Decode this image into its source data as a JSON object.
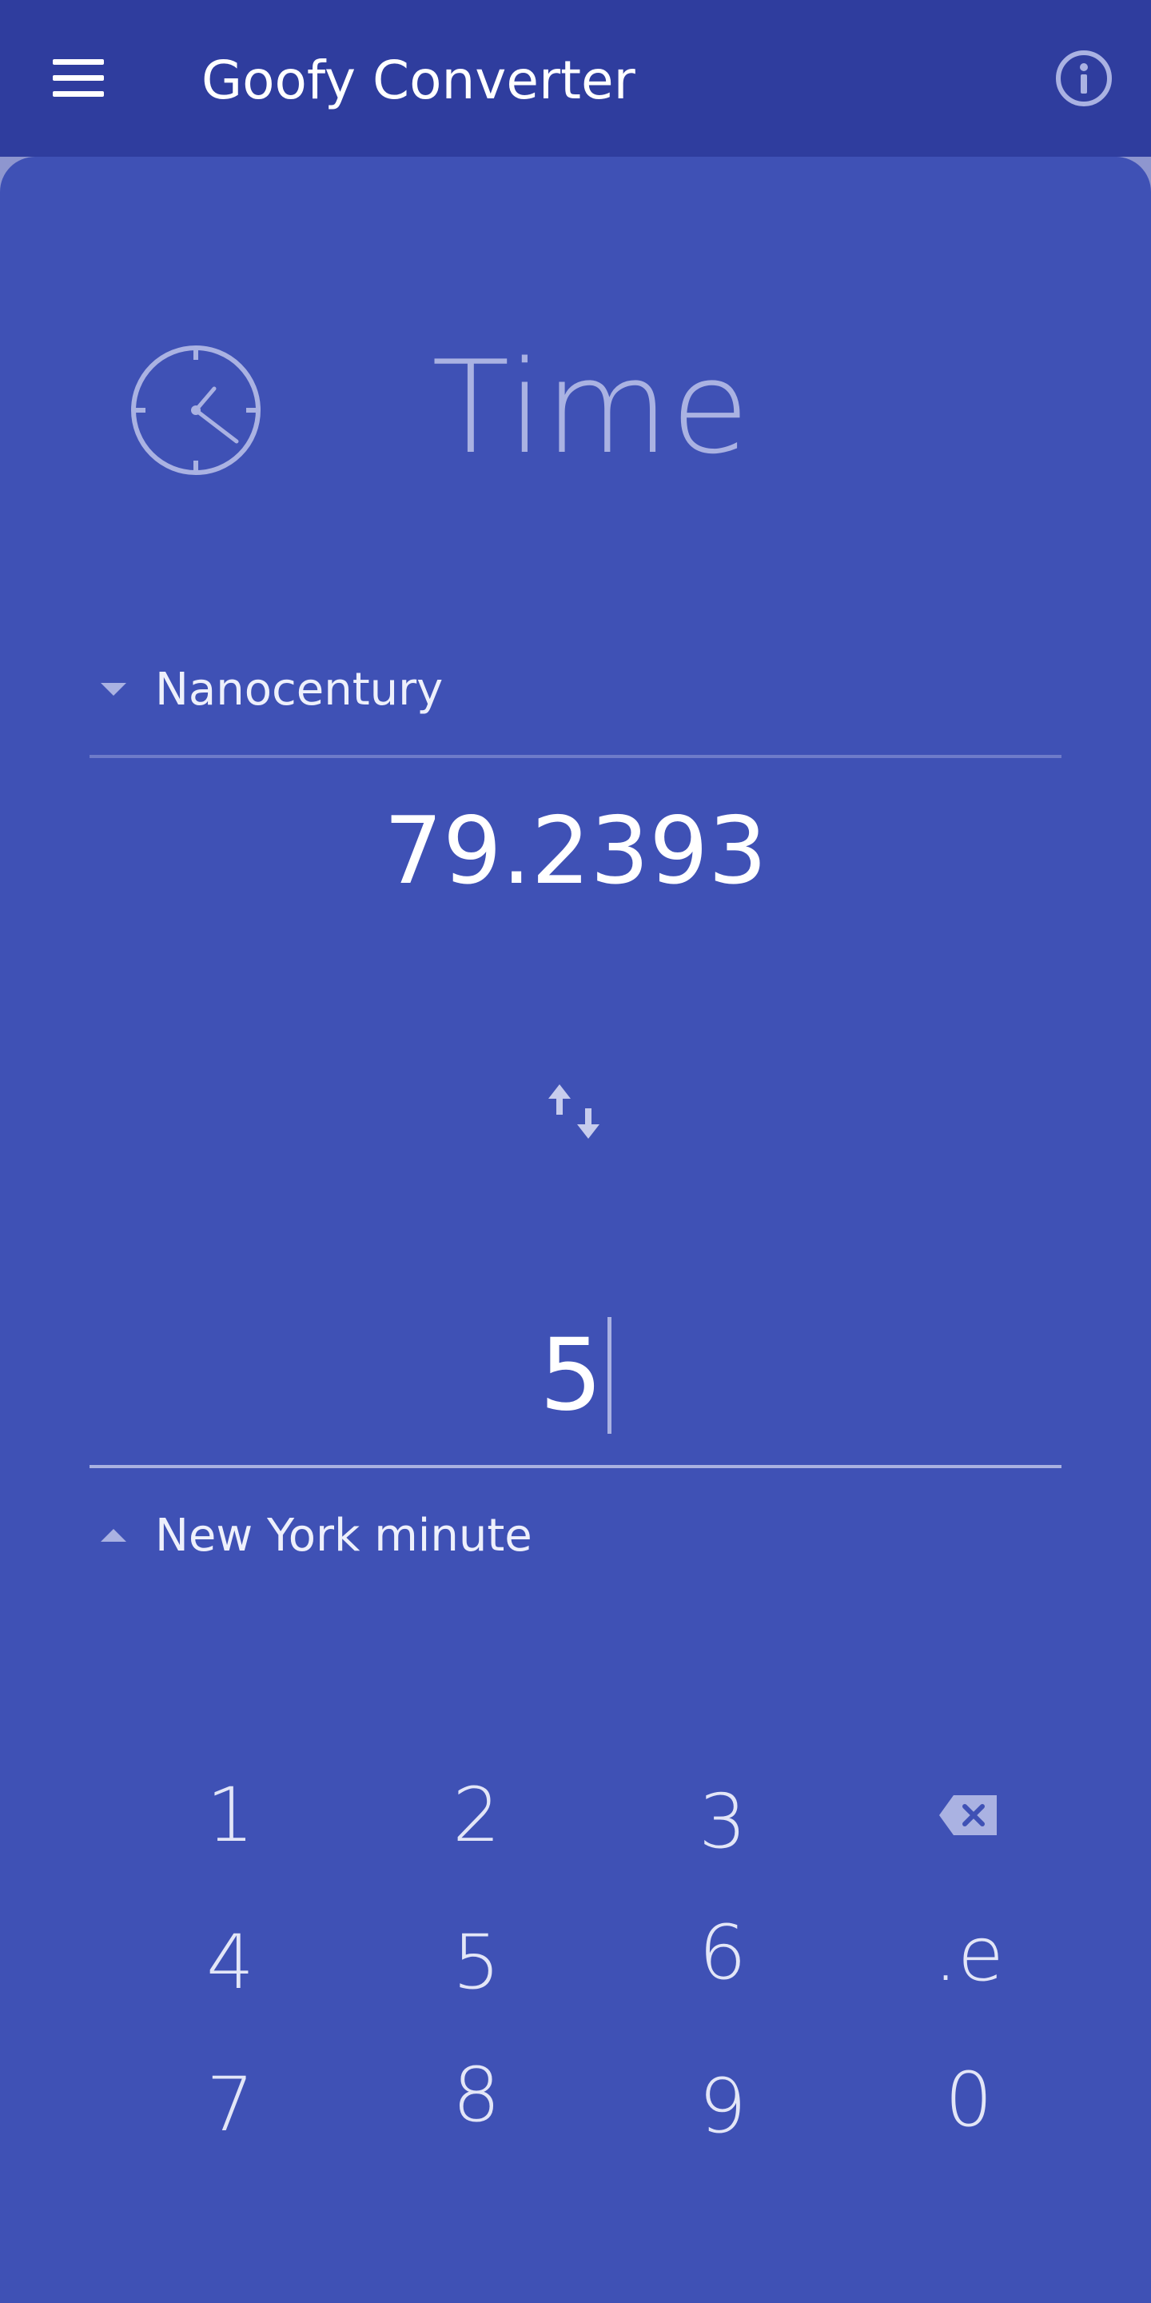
{
  "app": {
    "title": "Goofy Converter",
    "menu_icon": "hamburger-menu-icon",
    "info_icon": "info-icon"
  },
  "category": {
    "name": "Time",
    "icon": "clock-icon"
  },
  "converter": {
    "from_unit": "Nanocentury",
    "from_value": "79.2393",
    "to_value": "5",
    "to_unit": "New York minute",
    "swap_icon": "swap-vertical-icon"
  },
  "keypad": {
    "rows": [
      [
        "1",
        "2",
        "3",
        "backspace-icon"
      ],
      [
        "4",
        "5",
        "6",
        ".e"
      ],
      [
        "7",
        "8",
        "9",
        "0"
      ]
    ]
  },
  "colors": {
    "appbar": "#2f3d9e",
    "background": "#3f51b5",
    "accent_light": "#aab2e2"
  }
}
